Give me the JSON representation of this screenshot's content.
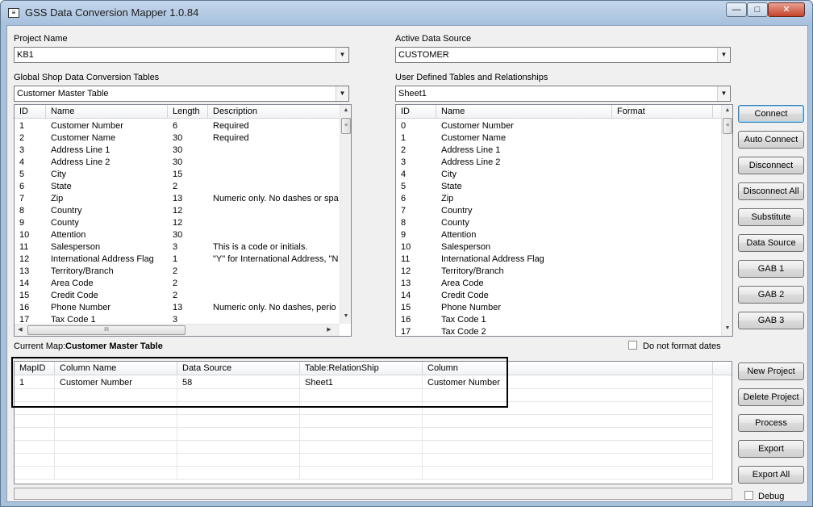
{
  "window": {
    "title": "GSS Data Conversion Mapper 1.0.84",
    "app_icon_glyph": "≡",
    "minimize_glyph": "—",
    "maximize_glyph": "□",
    "close_glyph": "✕"
  },
  "project": {
    "label": "Project Name",
    "value": "KB1"
  },
  "active_source": {
    "label": "Active Data Source",
    "value": "CUSTOMER"
  },
  "gs_tables": {
    "label": "Global Shop Data Conversion Tables",
    "value": "Customer Master Table"
  },
  "user_tables": {
    "label": "User Defined Tables and Relationships",
    "value": "Sheet1"
  },
  "gs_grid": {
    "headers": [
      "ID",
      "Name",
      "Length",
      "Description"
    ],
    "rows": [
      [
        "1",
        "Customer Number",
        "6",
        "Required"
      ],
      [
        "2",
        "Customer Name",
        "30",
        "Required"
      ],
      [
        "3",
        "Address Line 1",
        "30",
        ""
      ],
      [
        "4",
        "Address Line 2",
        "30",
        ""
      ],
      [
        "5",
        "City",
        "15",
        ""
      ],
      [
        "6",
        "State",
        "2",
        ""
      ],
      [
        "7",
        "Zip",
        "13",
        "Numeric only.  No dashes or spa"
      ],
      [
        "8",
        "Country",
        "12",
        ""
      ],
      [
        "9",
        "County",
        "12",
        ""
      ],
      [
        "10",
        "Attention",
        "30",
        ""
      ],
      [
        "11",
        "Salesperson",
        "3",
        "This is a code or initials."
      ],
      [
        "12",
        "International Address Flag",
        "1",
        "\"Y\" for International Address, \"N"
      ],
      [
        "13",
        "Territory/Branch",
        "2",
        ""
      ],
      [
        "14",
        "Area Code",
        "2",
        ""
      ],
      [
        "15",
        "Credit Code",
        "2",
        ""
      ],
      [
        "16",
        "Phone Number",
        "13",
        "Numeric only.  No dashes, perio"
      ],
      [
        "17",
        "Tax Code 1",
        "3",
        ""
      ]
    ]
  },
  "ud_grid": {
    "headers": [
      "ID",
      "Name",
      "Format"
    ],
    "rows": [
      [
        "0",
        "Customer Number",
        ""
      ],
      [
        "1",
        "Customer Name",
        ""
      ],
      [
        "2",
        "Address Line 1",
        ""
      ],
      [
        "3",
        "Address Line 2",
        ""
      ],
      [
        "4",
        "City",
        ""
      ],
      [
        "5",
        "State",
        ""
      ],
      [
        "6",
        "Zip",
        ""
      ],
      [
        "7",
        "Country",
        ""
      ],
      [
        "8",
        "County",
        ""
      ],
      [
        "9",
        "Attention",
        ""
      ],
      [
        "10",
        "Salesperson",
        ""
      ],
      [
        "11",
        "International Address Flag",
        ""
      ],
      [
        "12",
        "Territory/Branch",
        ""
      ],
      [
        "13",
        "Area Code",
        ""
      ],
      [
        "14",
        "Credit Code",
        ""
      ],
      [
        "15",
        "Phone Number",
        ""
      ],
      [
        "16",
        "Tax Code 1",
        ""
      ],
      [
        "17",
        "Tax Code 2",
        ""
      ]
    ]
  },
  "side_buttons": [
    "Connect",
    "Auto Connect",
    "Disconnect",
    "Disconnect All",
    "Substitute",
    "Data Source",
    "GAB 1",
    "GAB 2",
    "GAB 3"
  ],
  "current_map": {
    "label": "Current Map:",
    "value": "Customer Master Table"
  },
  "no_format_dates": {
    "label": "Do not format dates",
    "checked": false
  },
  "map_grid": {
    "headers": [
      "MapID",
      "Column Name",
      "Data Source",
      "Table:RelationShip",
      "Column"
    ],
    "rows": [
      [
        "1",
        "Customer Number",
        "58",
        "Sheet1",
        "Customer Number"
      ]
    ],
    "empty_rows": 7
  },
  "bottom_buttons": [
    "New Project",
    "Delete Project",
    "Process",
    "Export",
    "Export All"
  ],
  "debug": {
    "label": "Debug",
    "checked": false
  },
  "scroll_glyphs": {
    "up": "▲",
    "down": "▼",
    "left": "◀",
    "right": "▶",
    "grip_v": "≡",
    "grip_h": "III",
    "combo": "▼"
  }
}
